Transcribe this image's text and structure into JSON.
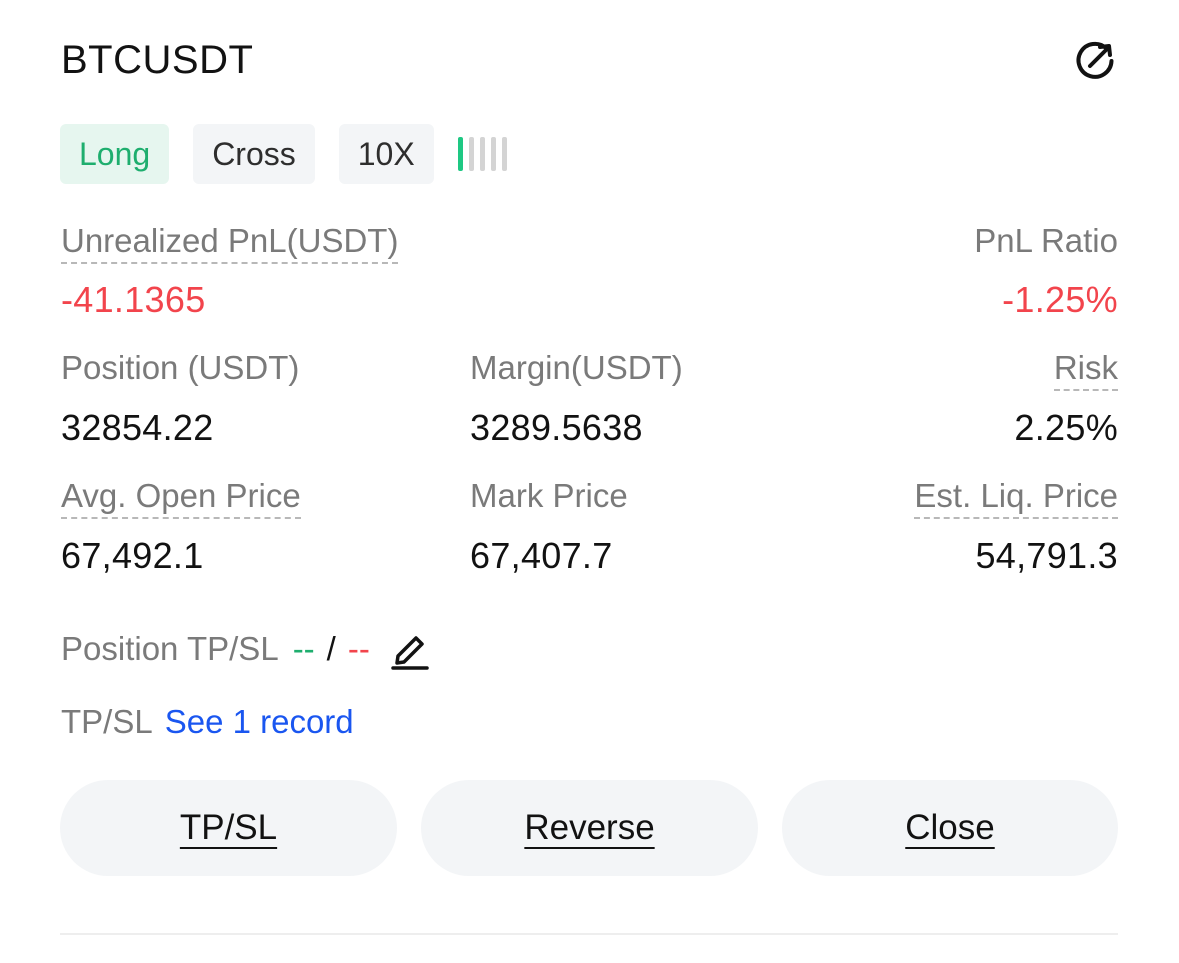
{
  "header": {
    "symbol": "BTCUSDT",
    "share_icon": "share-arrow-icon"
  },
  "tags": {
    "side": "Long",
    "margin_mode": "Cross",
    "leverage": "10X",
    "risk_level_filled": 1,
    "risk_level_total": 5
  },
  "colors": {
    "green": "#1eae6e",
    "red": "#f2444c",
    "link": "#1a56f0"
  },
  "pnl": {
    "label": "Unrealized PnL(USDT)",
    "value": "-41.1365",
    "ratio_label": "PnL Ratio",
    "ratio_value": "-1.25%"
  },
  "position": {
    "label": "Position (USDT)",
    "value": "32854.22"
  },
  "margin": {
    "label": "Margin(USDT)",
    "value": "3289.5638"
  },
  "risk": {
    "label": "Risk",
    "value": "2.25%"
  },
  "avg_open": {
    "label": "Avg. Open Price",
    "value": "67,492.1"
  },
  "mark": {
    "label": "Mark Price",
    "value": "67,407.7"
  },
  "liq": {
    "label": "Est. Liq. Price",
    "value": "54,791.3"
  },
  "tpsl": {
    "label": "Position TP/SL",
    "tp": "--",
    "separator": "/",
    "sl": "--",
    "edit_icon": "edit-pencil-icon"
  },
  "records": {
    "label": "TP/SL",
    "link": "See 1 record"
  },
  "actions": {
    "tpsl": "TP/SL",
    "reverse": "Reverse",
    "close": "Close"
  }
}
